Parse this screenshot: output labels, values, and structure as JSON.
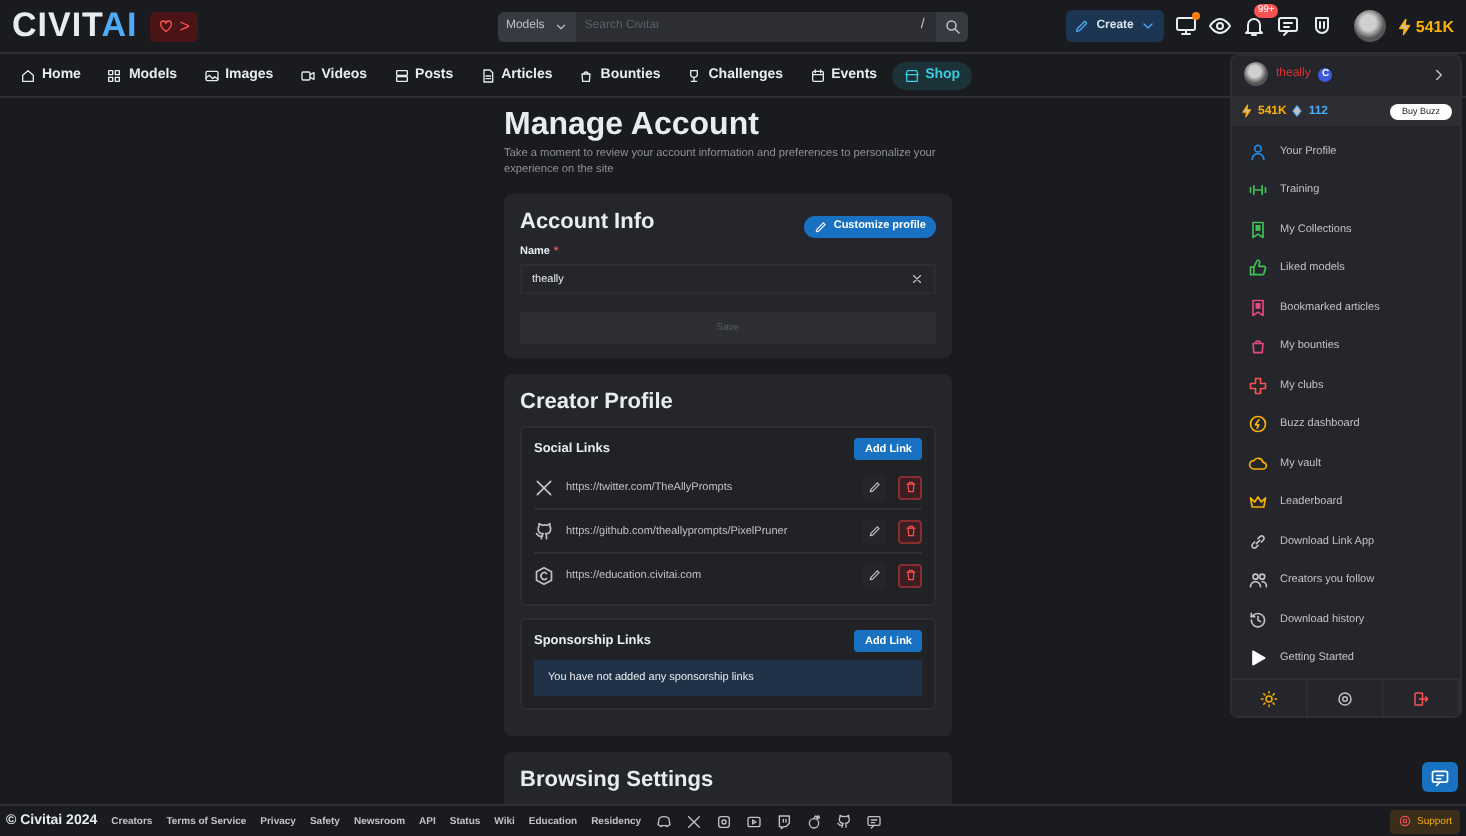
{
  "header": {
    "logo_main": "CIVIT",
    "logo_accent": "AI",
    "support_arrow": ">",
    "search": {
      "scope": "Models",
      "placeholder": "Search Civitai",
      "shortcut": "/"
    },
    "create_label": "Create",
    "notification_count": "99+",
    "buzz": "541K"
  },
  "nav": [
    {
      "label": "Home",
      "selected": false
    },
    {
      "label": "Models",
      "selected": false
    },
    {
      "label": "Images",
      "selected": false
    },
    {
      "label": "Videos",
      "selected": false
    },
    {
      "label": "Posts",
      "selected": false
    },
    {
      "label": "Articles",
      "selected": false
    },
    {
      "label": "Bounties",
      "selected": false
    },
    {
      "label": "Challenges",
      "selected": false
    },
    {
      "label": "Events",
      "selected": false
    },
    {
      "label": "Shop",
      "selected": true
    }
  ],
  "page": {
    "title": "Manage Account",
    "subtitle": "Take a moment to review your account information and preferences to personalize your experience on the site"
  },
  "account_info": {
    "title": "Account Info",
    "customize_label": "Customize profile",
    "name_label": "Name",
    "required_mark": "*",
    "name_value": "theally",
    "save_label": "Save",
    "save_disabled": true
  },
  "creator_profile": {
    "title": "Creator Profile",
    "social_title": "Social Links",
    "add_label": "Add Link",
    "social_links": [
      {
        "kind": "x",
        "url": "https://twitter.com/TheAllyPrompts"
      },
      {
        "kind": "github",
        "url": "https://github.com/theallyprompts/PixelPruner"
      },
      {
        "kind": "civitai",
        "url": "https://education.civitai.com"
      }
    ],
    "sponsorship_title": "Sponsorship Links",
    "sponsorship_add_label": "Add Link",
    "sponsorship_empty": "You have not added any sponsorship links"
  },
  "next_section": {
    "title": "Browsing Settings"
  },
  "user_menu": {
    "username": "theally",
    "badge": "C",
    "buzz_yellow": "541K",
    "buzz_blue": "112",
    "buy_label": "Buy Buzz",
    "items": [
      {
        "label": "Your Profile",
        "color": "#228be6"
      },
      {
        "label": "Training",
        "color": "#40c057"
      },
      {
        "label": "My Collections",
        "color": "#40c057"
      },
      {
        "label": "Liked models",
        "color": "#40c057"
      },
      {
        "label": "Bookmarked articles",
        "color": "#e64980"
      },
      {
        "label": "My bounties",
        "color": "#e64980"
      },
      {
        "label": "My clubs",
        "color": "#fa5252"
      },
      {
        "label": "Buzz dashboard",
        "color": "#fab005"
      },
      {
        "label": "My vault",
        "color": "#fab005"
      },
      {
        "label": "Leaderboard",
        "color": "#fab005"
      },
      {
        "label": "Download Link App",
        "color": "#c1c2c5"
      },
      {
        "label": "Creators you follow",
        "color": "#c1c2c5"
      },
      {
        "label": "Download history",
        "color": "#c1c2c5"
      },
      {
        "label": "Getting Started",
        "color": "#ffffff"
      }
    ]
  },
  "footer": {
    "copyright": "© Civitai 2024",
    "links": [
      "Creators",
      "Terms of Service",
      "Privacy",
      "Safety",
      "Newsroom",
      "API",
      "Status",
      "Wiki",
      "Education",
      "Residency"
    ],
    "support_label": "Support"
  }
}
